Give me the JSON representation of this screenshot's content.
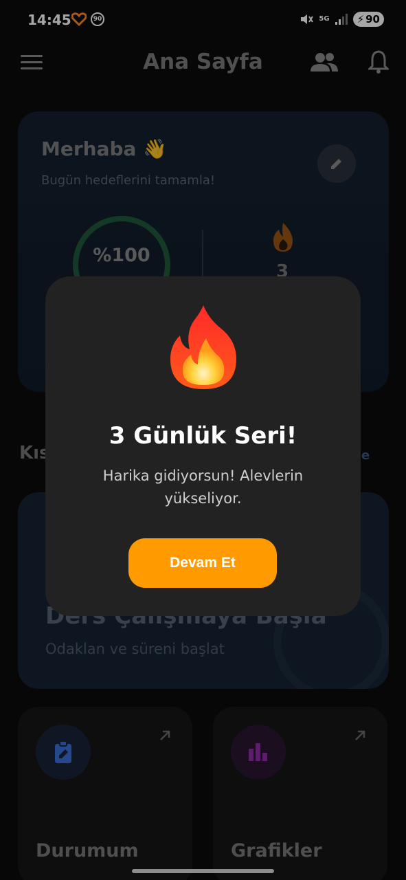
{
  "status_bar": {
    "time": "14:45",
    "badge": "90",
    "network": "5G",
    "battery": "90"
  },
  "app_bar": {
    "title": "Ana Sayfa"
  },
  "hero": {
    "greeting": "Merhaba 👋",
    "subtitle": "Bugün hedeflerini tamamla!",
    "progress_text": "%100",
    "progress_value": 1.0,
    "streak_count": "3"
  },
  "sections": {
    "left_heading_partial": "Kıs",
    "right_link_partial": "e"
  },
  "study_card": {
    "title": "Ders Çalışmaya Başla",
    "subtitle": "Odaklan ve süreni başlat"
  },
  "tiles": [
    {
      "label": "Durumum",
      "icon": "clipboard-edit-icon",
      "color": "#3a6fd8"
    },
    {
      "label": "Grafikler",
      "icon": "bar-chart-icon",
      "color": "#b23ad0"
    }
  ],
  "modal": {
    "icon": "fire-icon",
    "title": "3 Günlük Seri!",
    "message": "Harika gidiyorsun! Alevlerin yükseliyor.",
    "button": "Devam Et",
    "accent": "#ff9a00"
  }
}
